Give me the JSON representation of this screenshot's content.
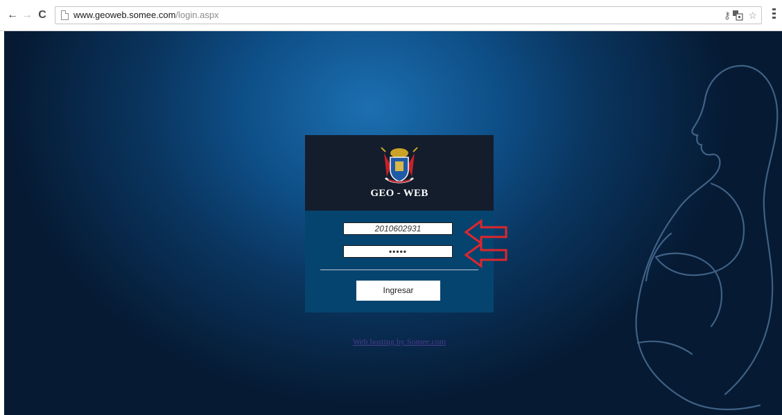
{
  "browser": {
    "url_host": "www.geoweb.somee.com",
    "url_path": "/login.aspx",
    "back_glyph": "←",
    "forward_glyph": "→",
    "reload_glyph": "C",
    "icons": [
      "back-arrow-icon",
      "forward-arrow-icon",
      "reload-icon",
      "page-icon",
      "key-icon",
      "translate-icon",
      "star-icon",
      "menu-icon"
    ]
  },
  "login": {
    "title": "GEO - WEB",
    "username_value": "2010602931",
    "password_mask": "•••••",
    "submit_label": "Ingresar"
  },
  "footer": {
    "link_text": "Web hosting by Somee.com"
  },
  "colors": {
    "background_center": "#1c6fb0",
    "background_edge": "#061a33",
    "header_bg": "#141d2c",
    "panel_bg": "#064470",
    "annotation_arrow": "#e0262b",
    "link": "#4b3a8e"
  }
}
